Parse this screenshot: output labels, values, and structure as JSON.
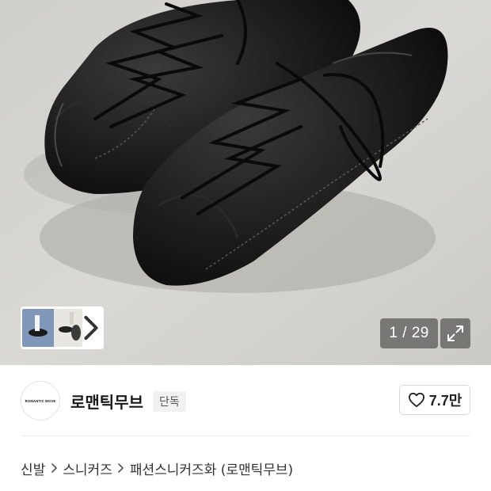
{
  "gallery": {
    "current": "1",
    "separator": "/",
    "total": "29",
    "expand_icon": "expand-arrows-icon",
    "thumb_next_icon": "chevron-right-icon"
  },
  "brand": {
    "logo_text": "ROMANTIC MOVE",
    "name": "로맨틱무브",
    "badge": "단독",
    "like_icon": "heart-outline-icon",
    "like_count": "7.7만"
  },
  "breadcrumb": {
    "items": [
      "신발",
      "스니커즈",
      "패션스니커즈화 (로맨틱무브)"
    ],
    "separator_icon": "chevron-right-icon"
  },
  "colors": {
    "counter_bg": "#00000069",
    "badge_bg": "#f1f1f1",
    "divider": "#ececec"
  }
}
